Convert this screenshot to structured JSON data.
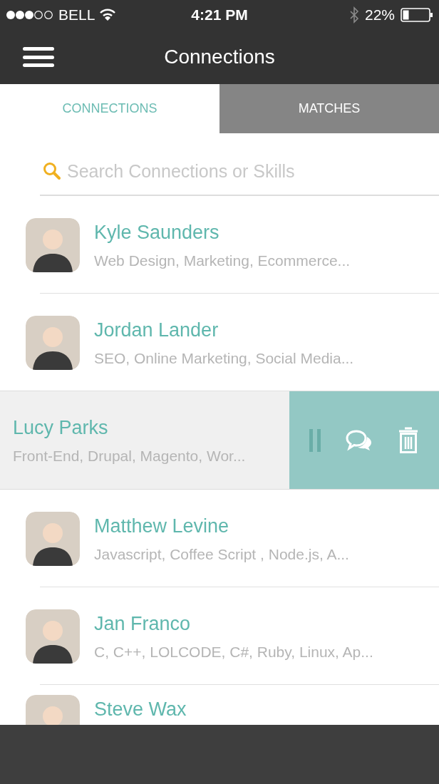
{
  "status_bar": {
    "carrier": "BELL",
    "time": "4:21 PM",
    "battery": "22%"
  },
  "header": {
    "title": "Connections"
  },
  "tabs": [
    {
      "label": "CONNECTIONS",
      "selected": true
    },
    {
      "label": "MATCHES",
      "selected": false
    }
  ],
  "search": {
    "placeholder": "Search Connections or Skills"
  },
  "connections": [
    {
      "name": "Kyle Saunders",
      "skills": "Web Design, Marketing, Ecommerce...",
      "swiped": false
    },
    {
      "name": "Jordan Lander",
      "skills": "SEO, Online Marketing, Social Media...",
      "swiped": false
    },
    {
      "name": "Lucy Parks",
      "skills": "Front-End, Drupal, Magento, Wor...",
      "swiped": true
    },
    {
      "name": "Matthew Levine",
      "skills": "Javascript, Coffee Script , Node.js,  A...",
      "swiped": false
    },
    {
      "name": "Jan Franco",
      "skills": "C, C++, LOLCODE, C#, Ruby, Linux, Ap...",
      "swiped": false
    },
    {
      "name": "Steve Wax",
      "swiped": false
    }
  ]
}
